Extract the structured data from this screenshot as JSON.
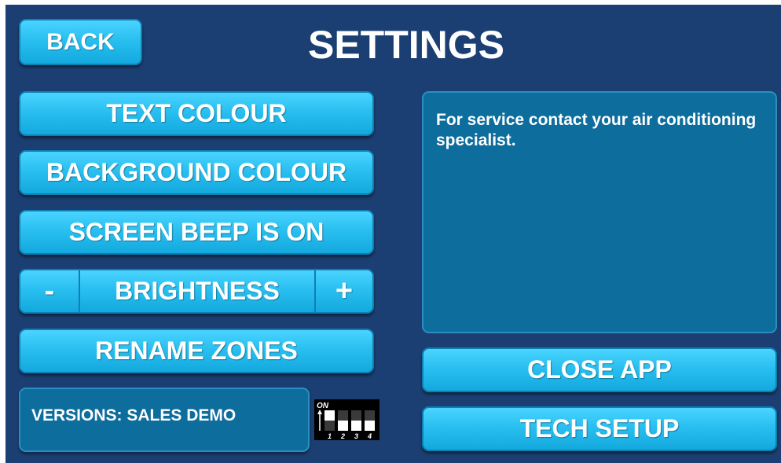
{
  "header": {
    "back_label": "BACK",
    "title": "SETTINGS"
  },
  "menu": {
    "text_colour": "TEXT COLOUR",
    "background_colour": "BACKGROUND COLOUR",
    "screen_beep": "SCREEN BEEP IS ON",
    "brightness": {
      "minus": "-",
      "label": "BRIGHTNESS",
      "plus": "+"
    },
    "rename_zones": "RENAME ZONES"
  },
  "info_panel": {
    "message": "For service contact your air conditioning specialist."
  },
  "actions": {
    "close_app": "CLOSE APP",
    "tech_setup": "TECH SETUP"
  },
  "versions": {
    "label": "VERSIONS: SALES DEMO"
  },
  "dip_switch": {
    "on_label": "ON",
    "switch_numbers": [
      "1",
      "2",
      "3",
      "4"
    ],
    "states": [
      true,
      false,
      false,
      false
    ],
    "icon": "dip-switch-icon"
  },
  "colors": {
    "background": "#1b3f72",
    "button": "#29bff0",
    "panel": "#0d6d9c",
    "text": "#ffffff"
  }
}
